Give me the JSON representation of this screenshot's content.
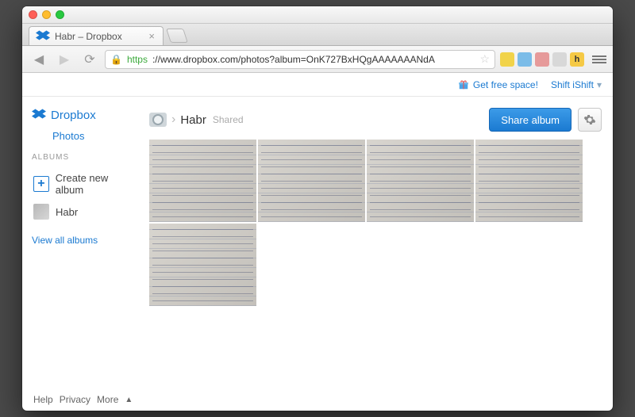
{
  "browser": {
    "tab_title": "Habr – Dropbox",
    "url_https_label": "https",
    "url_rest": "://www.dropbox.com/photos?album=OnK727BxHQgAAAAAAANdA"
  },
  "header": {
    "free_space_label": "Get free space!",
    "user_label": "Shift iShift"
  },
  "sidebar": {
    "brand": "Dropbox",
    "photos_label": "Photos",
    "albums_heading": "ALBUMS",
    "create_label": "Create new album",
    "albums": [
      {
        "name": "Habr"
      }
    ],
    "view_all_label": "View all albums"
  },
  "panel": {
    "breadcrumb_current": "Habr",
    "shared_label": "Shared",
    "share_button_label": "Share album"
  },
  "photos": [
    {
      "id": "photo-1"
    },
    {
      "id": "photo-2"
    },
    {
      "id": "photo-3"
    },
    {
      "id": "photo-4"
    },
    {
      "id": "photo-5"
    }
  ],
  "footer": {
    "help": "Help",
    "privacy": "Privacy",
    "more": "More"
  }
}
